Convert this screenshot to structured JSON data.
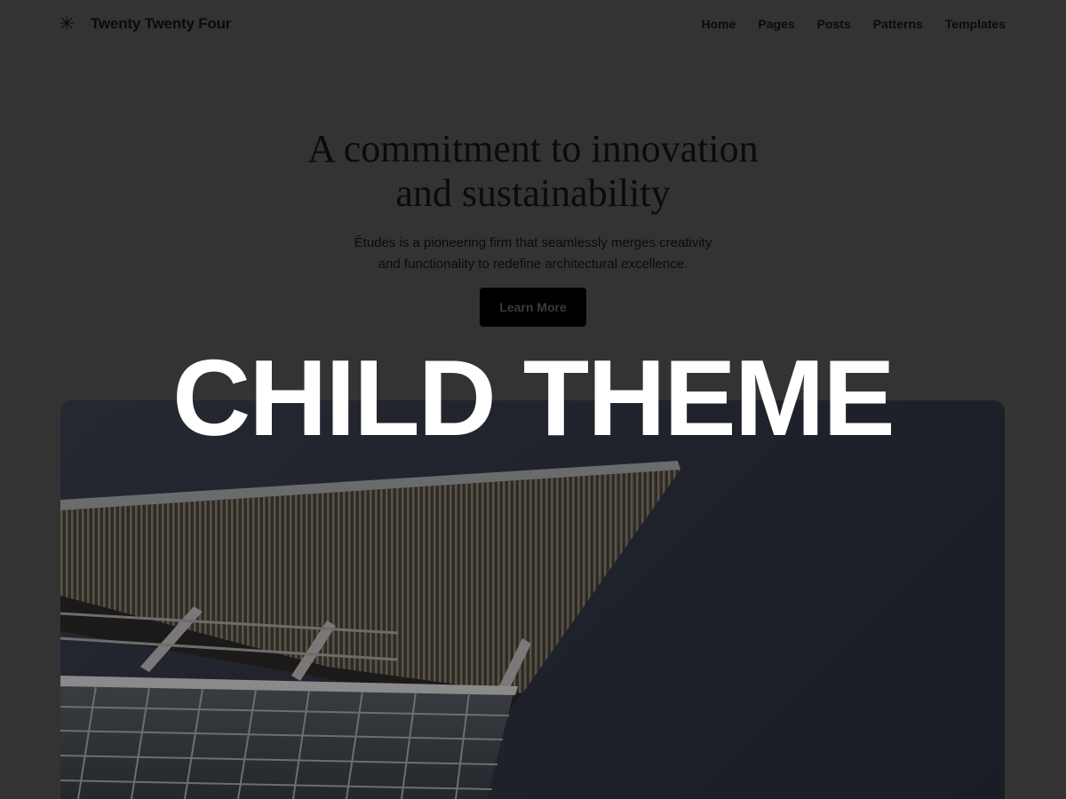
{
  "header": {
    "logo_icon": "asterisk-icon",
    "logo_glyph": "✳",
    "site_title": "Twenty Twenty Four",
    "nav": [
      {
        "label": "Home"
      },
      {
        "label": "Pages"
      },
      {
        "label": "Posts"
      },
      {
        "label": "Patterns"
      },
      {
        "label": "Templates"
      }
    ]
  },
  "hero": {
    "heading_line1": "A commitment to innovation",
    "heading_line2": "and sustainability",
    "text_line1": "Études is a pioneering firm that seamlessly merges creativity",
    "text_line2": "and functionality to redefine architectural excellence.",
    "button_label": "Learn More",
    "image": "architecture-building-photo"
  },
  "overlay": {
    "title": "CHILD THEME"
  },
  "colors": {
    "page_background": "#333333",
    "text": "#0b0b0b",
    "button_background": "#000000",
    "overlay_text": "#ffffff"
  }
}
